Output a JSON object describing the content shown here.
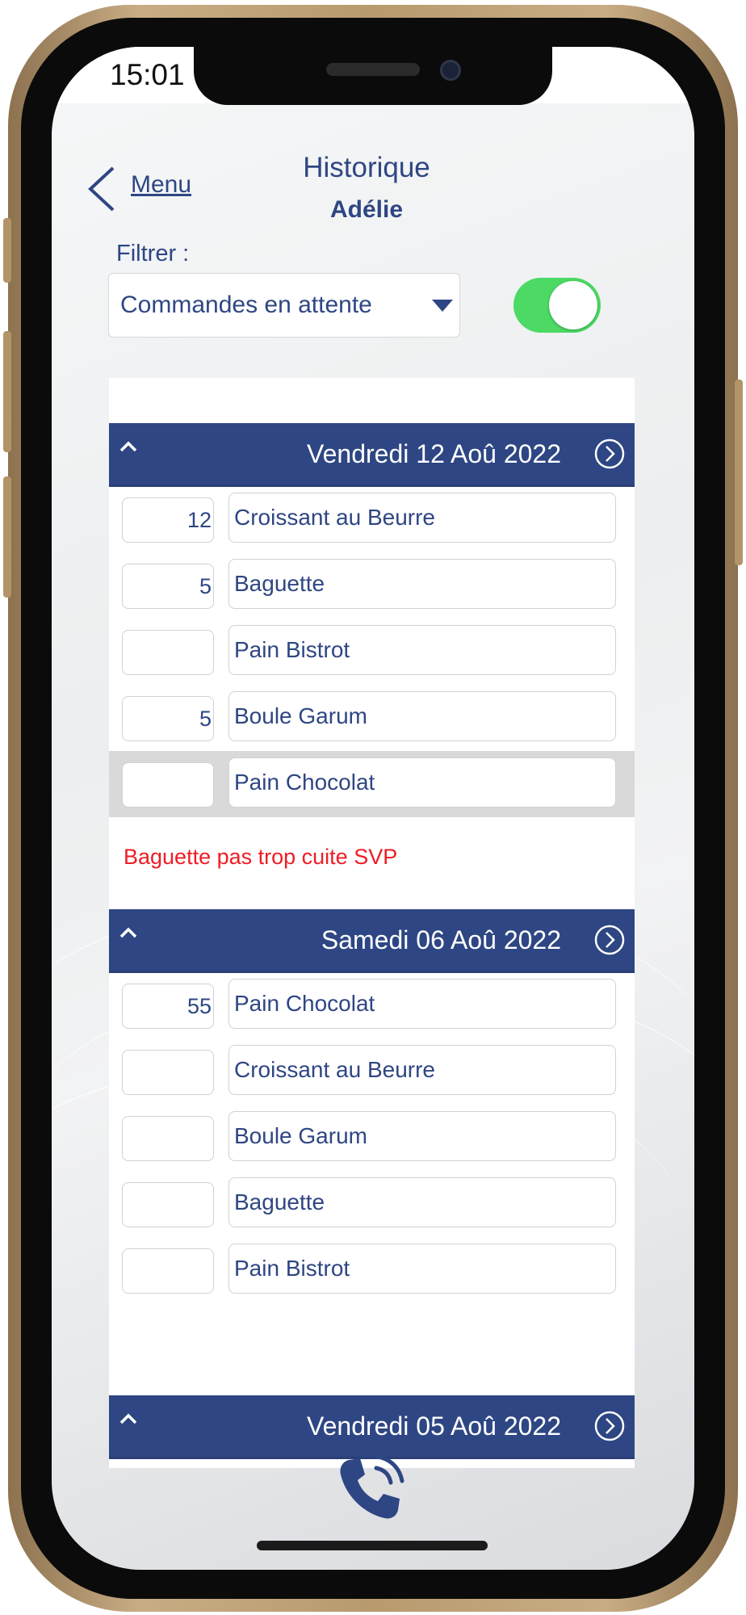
{
  "status_bar": {
    "time": "15:01"
  },
  "header": {
    "back_label": "Menu",
    "title": "Historique",
    "subtitle": "Adélie"
  },
  "filter": {
    "label": "Filtrer :",
    "selected": "Commandes en attente",
    "toggle_on": true
  },
  "colors": {
    "accent": "#2e4683",
    "toggle": "#4cd964",
    "note": "#ee1c24"
  },
  "groups": [
    {
      "date": "Vendredi 12 Aoû 2022",
      "items": [
        {
          "qty": "12",
          "name": "Croissant au Beurre"
        },
        {
          "qty": "5",
          "name": "Baguette"
        },
        {
          "qty": "",
          "name": "Pain Bistrot"
        },
        {
          "qty": "5",
          "name": "Boule Garum"
        },
        {
          "qty": "",
          "name": "Pain Chocolat"
        }
      ],
      "note": "Baguette pas trop cuite SVP"
    },
    {
      "date": "Samedi 06 Aoû 2022",
      "items": [
        {
          "qty": "55",
          "name": "Pain Chocolat"
        },
        {
          "qty": "",
          "name": "Croissant au Beurre"
        },
        {
          "qty": "",
          "name": "Boule Garum"
        },
        {
          "qty": "",
          "name": "Baguette"
        },
        {
          "qty": "",
          "name": "Pain Bistrot"
        }
      ]
    },
    {
      "date": "Vendredi 05 Aoû 2022",
      "items": []
    }
  ],
  "icons": {
    "back": "chevron-left-icon",
    "dropdown": "triangle-down-icon",
    "group_collapse": "chevron-up-icon",
    "group_open": "circle-chevron-right-icon",
    "call": "phone-call-icon"
  }
}
